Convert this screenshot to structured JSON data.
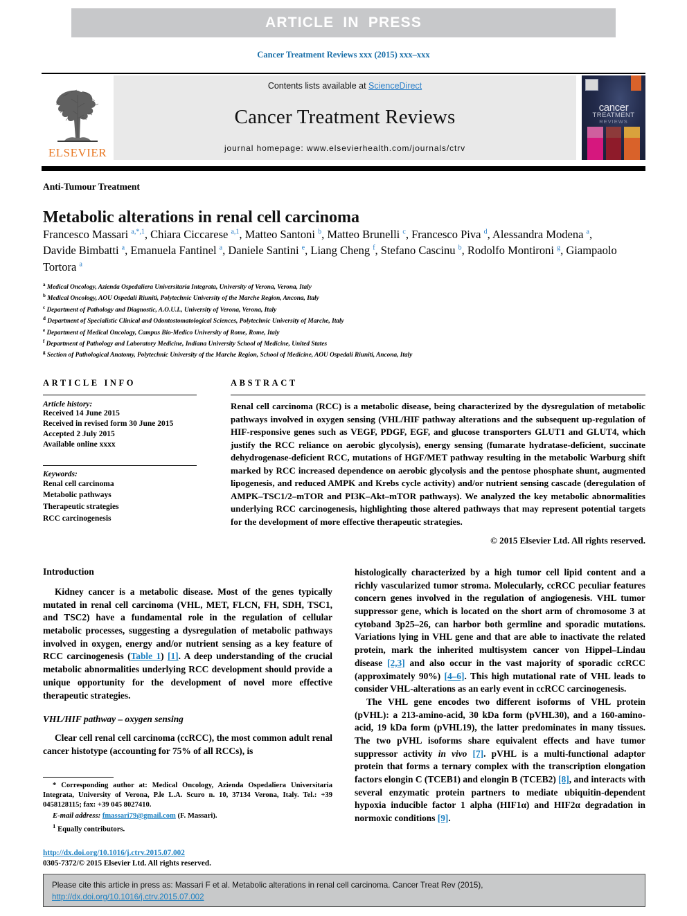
{
  "banner": {
    "text": "ARTICLE  IN  PRESS"
  },
  "running_head": "Cancer Treatment Reviews xxx (2015) xxx–xxx",
  "masthead": {
    "contents_prefix": "Contents lists available at ",
    "sciencedirect": "ScienceDirect",
    "journal_title": "Cancer Treatment Reviews",
    "homepage": "journal homepage: www.elsevierhealth.com/journals/ctrv",
    "publisher": "ELSEVIER",
    "cover": {
      "word1": "cancer",
      "word2": "TREATMENT",
      "word3": "REVIEWS"
    }
  },
  "title_block": {
    "kicker": "Anti-Tumour Treatment",
    "title": "Metabolic alterations in renal cell carcinoma",
    "authors_html": "Francesco Massari <sup>a,*,1</sup>, Chiara Ciccarese <sup>a,1</sup>, Matteo Santoni <sup>b</sup>, Matteo Brunelli <sup>c</sup>, Francesco Piva <sup>d</sup>, Alessandra Modena <sup>a</sup>, Davide Bimbatti <sup>a</sup>, Emanuela Fantinel <sup>a</sup>, Daniele Santini <sup>e</sup>, Liang Cheng <sup>f</sup>, Stefano Cascinu <sup>b</sup>, Rodolfo Montironi <sup>g</sup>, Giampaolo Tortora <sup>a</sup>",
    "affiliations": [
      {
        "marker": "a",
        "text": "Medical Oncology, Azienda Ospedaliera Universitaria Integrata, University of Verona, Verona, Italy"
      },
      {
        "marker": "b",
        "text": "Medical Oncology, AOU Ospedali Riuniti, Polytechnic University of the Marche Region, Ancona, Italy"
      },
      {
        "marker": "c",
        "text": "Department of Pathology and Diagnostic, A.O.U.I., University of Verona, Verona, Italy"
      },
      {
        "marker": "d",
        "text": "Department of Specialistic Clinical and Odontostomatological Sciences, Polytechnic University of Marche, Italy"
      },
      {
        "marker": "e",
        "text": "Department of Medical Oncology, Campus Bio-Medico University of Rome, Rome, Italy"
      },
      {
        "marker": "f",
        "text": "Department of Pathology and Laboratory Medicine, Indiana University School of Medicine, United States"
      },
      {
        "marker": "g",
        "text": "Section of Pathological Anatomy, Polytechnic University of the Marche Region, School of Medicine, AOU Ospedali Riuniti, Ancona, Italy"
      }
    ]
  },
  "article_info": {
    "heading": "ARTICLE INFO",
    "history_label": "Article history:",
    "history": [
      "Received 14 June 2015",
      "Received in revised form 30 June 2015",
      "Accepted 2 July 2015",
      "Available online xxxx"
    ],
    "keywords_label": "Keywords:",
    "keywords": [
      "Renal cell carcinoma",
      "Metabolic pathways",
      "Therapeutic strategies",
      "RCC carcinogenesis"
    ]
  },
  "abstract": {
    "heading": "ABSTRACT",
    "body": "Renal cell carcinoma (RCC) is a metabolic disease, being characterized by the dysregulation of metabolic pathways involved in oxygen sensing (VHL/HIF pathway alterations and the subsequent up-regulation of HIF-responsive genes such as VEGF, PDGF, EGF, and glucose transporters GLUT1 and GLUT4, which justify the RCC reliance on aerobic glycolysis), energy sensing (fumarate hydratase-deficient, succinate dehydrogenase-deficient RCC, mutations of HGF/MET pathway resulting in the metabolic Warburg shift marked by RCC increased dependence on aerobic glycolysis and the pentose phosphate shunt, augmented lipogenesis, and reduced AMPK and Krebs cycle activity) and/or nutrient sensing cascade (deregulation of AMPK–TSC1/2–mTOR and PI3K–Akt–mTOR pathways). We analyzed the key metabolic abnormalities underlying RCC carcinogenesis, highlighting those altered pathways that may represent potential targets for the development of more effective therapeutic strategies.",
    "copyright": "© 2015 Elsevier Ltd. All rights reserved."
  },
  "body": {
    "intro_heading": "Introduction",
    "intro_p1_a": "Kidney cancer is a metabolic disease. Most of the genes typically mutated in renal cell carcinoma (VHL, MET, FLCN, FH, SDH, TSC1, and TSC2) have a fundamental role in the regulation of cellular metabolic processes, suggesting a dysregulation of metabolic pathways involved in oxygen, energy and/or nutrient sensing as a key feature of RCC carcinogenesis (",
    "intro_link_table": "Table 1",
    "intro_p1_b": ") ",
    "intro_link_ref1": "[1]",
    "intro_p1_c": ". A deep understanding of the crucial metabolic abnormalities underlying RCC development should provide a unique opportunity for the development of novel more effective therapeutic strategies.",
    "vhl_subhead": "VHL/HIF pathway – oxygen sensing",
    "vhl_p1": "Clear cell renal cell carcinoma (ccRCC), the most common adult renal cancer histotype (accounting for 75% of all RCCs), is",
    "right_p1_a": "histologically characterized by a high tumor cell lipid content and a richly vascularized tumor stroma. Molecularly, ccRCC peculiar features concern genes involved in the regulation of angiogenesis. VHL tumor suppressor gene, which is located on the short arm of chromosome 3 at cytoband 3p25–26, can harbor both germline and sporadic mutations. Variations lying in VHL gene and that are able to inactivate the related protein, mark the inherited multisystem cancer von Hippel–Lindau disease ",
    "right_ref23": "[2,3]",
    "right_p1_b": " and also occur in the vast majority of sporadic ccRCC (approximately 90%) ",
    "right_ref46": "[4–6]",
    "right_p1_c": ". This high mutational rate of VHL leads to consider VHL-alterations as an early event in ccRCC carcinogenesis.",
    "right_p2_a": "The VHL gene encodes two different isoforms of VHL protein (pVHL): a 213-amino-acid, 30 kDa form (pVHL30), and a 160-amino-acid, 19 kDa form (pVHL19), the latter predominates in many tissues. The two pVHL isoforms share equivalent effects and have tumor suppressor activity ",
    "right_p2_invivo": "in vivo",
    "right_p2_b": " ",
    "right_ref7": "[7]",
    "right_p2_c": ". pVHL is a multi-functional adaptor protein that forms a ternary complex with the transcription elongation factors elongin C (TCEB1) and elongin B (TCEB2) ",
    "right_ref8": "[8]",
    "right_p2_d": ", and interacts with several enzymatic protein partners to mediate ubiquitin-dependent hypoxia inducible factor 1 alpha (HIF1α) and HIF2α degradation in normoxic conditions ",
    "right_ref9": "[9]",
    "right_p2_e": "."
  },
  "footnotes": {
    "corresponding_marker": "*",
    "corresponding": "Corresponding author at: Medical Oncology, Azienda Ospedaliera Universitaria Integrata, University of Verona, P.le L.A. Scuro n. 10, 37134 Verona, Italy. Tel.: +39 0458128115; fax: +39 045 8027410.",
    "email_label": "E-mail address:",
    "email": "fmassari79@gmail.com",
    "email_suffix": "(F. Massari).",
    "equal_marker": "1",
    "equal_text": "Equally contributors."
  },
  "doi_block": {
    "doi_url": "http://dx.doi.org/10.1016/j.ctrv.2015.07.002",
    "issn_line": "0305-7372/© 2015 Elsevier Ltd. All rights reserved."
  },
  "cite_footer": {
    "text": "Please cite this article in press as: Massari F et al. Metabolic alterations in renal cell carcinoma. Cancer Treat Rev (2015), ",
    "link": "http://dx.doi.org/10.1016/j.ctrv.2015.07.002"
  },
  "colors": {
    "link_blue": "#1a7fc1",
    "banner_gray": "#c7c8ca",
    "elsevier_orange": "#e87722"
  }
}
